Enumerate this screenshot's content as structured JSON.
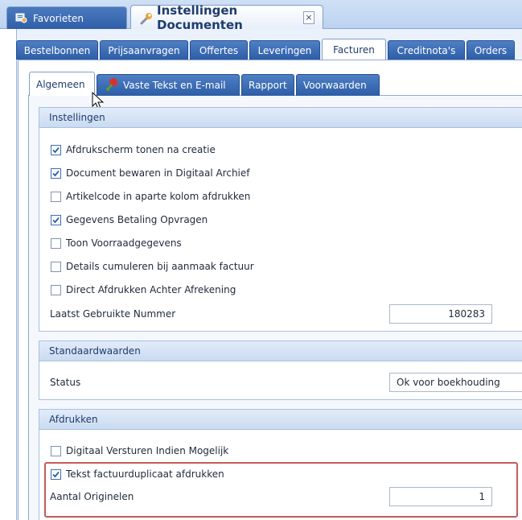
{
  "doc_tabs": [
    {
      "label": "Favorieten"
    },
    {
      "label": "Instellingen Documenten",
      "close": "×"
    }
  ],
  "main_tabs": [
    {
      "label": "Bestelbonnen"
    },
    {
      "label": "Prijsaanvragen"
    },
    {
      "label": "Offertes"
    },
    {
      "label": "Leveringen"
    },
    {
      "label": "Facturen"
    },
    {
      "label": "Creditnota's"
    },
    {
      "label": "Orders"
    }
  ],
  "sub_tabs": [
    {
      "label": "Algemeen"
    },
    {
      "label": "Vaste Tekst en E-mail"
    },
    {
      "label": "Rapport"
    },
    {
      "label": "Voorwaarden"
    }
  ],
  "groups": {
    "instellingen": {
      "title": "Instellingen",
      "checkboxes": [
        {
          "label": "Afdrukscherm tonen na creatie",
          "checked": true
        },
        {
          "label": "Document bewaren in Digitaal Archief",
          "checked": true
        },
        {
          "label": "Artikelcode in aparte kolom afdrukken",
          "checked": false
        },
        {
          "label": "Gegevens Betaling Opvragen",
          "checked": true
        },
        {
          "label": "Toon Voorraadgegevens",
          "checked": false
        },
        {
          "label": "Details cumuleren bij aanmaak factuur",
          "checked": false
        },
        {
          "label": "Direct Afdrukken Achter Afrekening",
          "checked": false
        }
      ],
      "last_number_label": "Laatst Gebruikte Nummer",
      "last_number_value": "180283"
    },
    "standaardwaarden": {
      "title": "Standaardwaarden",
      "status_label": "Status",
      "status_value": "Ok voor boekhouding"
    },
    "afdrukken": {
      "title": "Afdrukken",
      "checkboxes": [
        {
          "label": "Digitaal Versturen Indien Mogelijk",
          "checked": false
        },
        {
          "label": "Tekst factuurduplicaat afdrukken",
          "checked": true
        }
      ],
      "originals_label": "Aantal Originelen",
      "originals_value": "1"
    }
  },
  "colors": {
    "accent": "#2d5da6",
    "highlight_border": "#c85a5a"
  }
}
